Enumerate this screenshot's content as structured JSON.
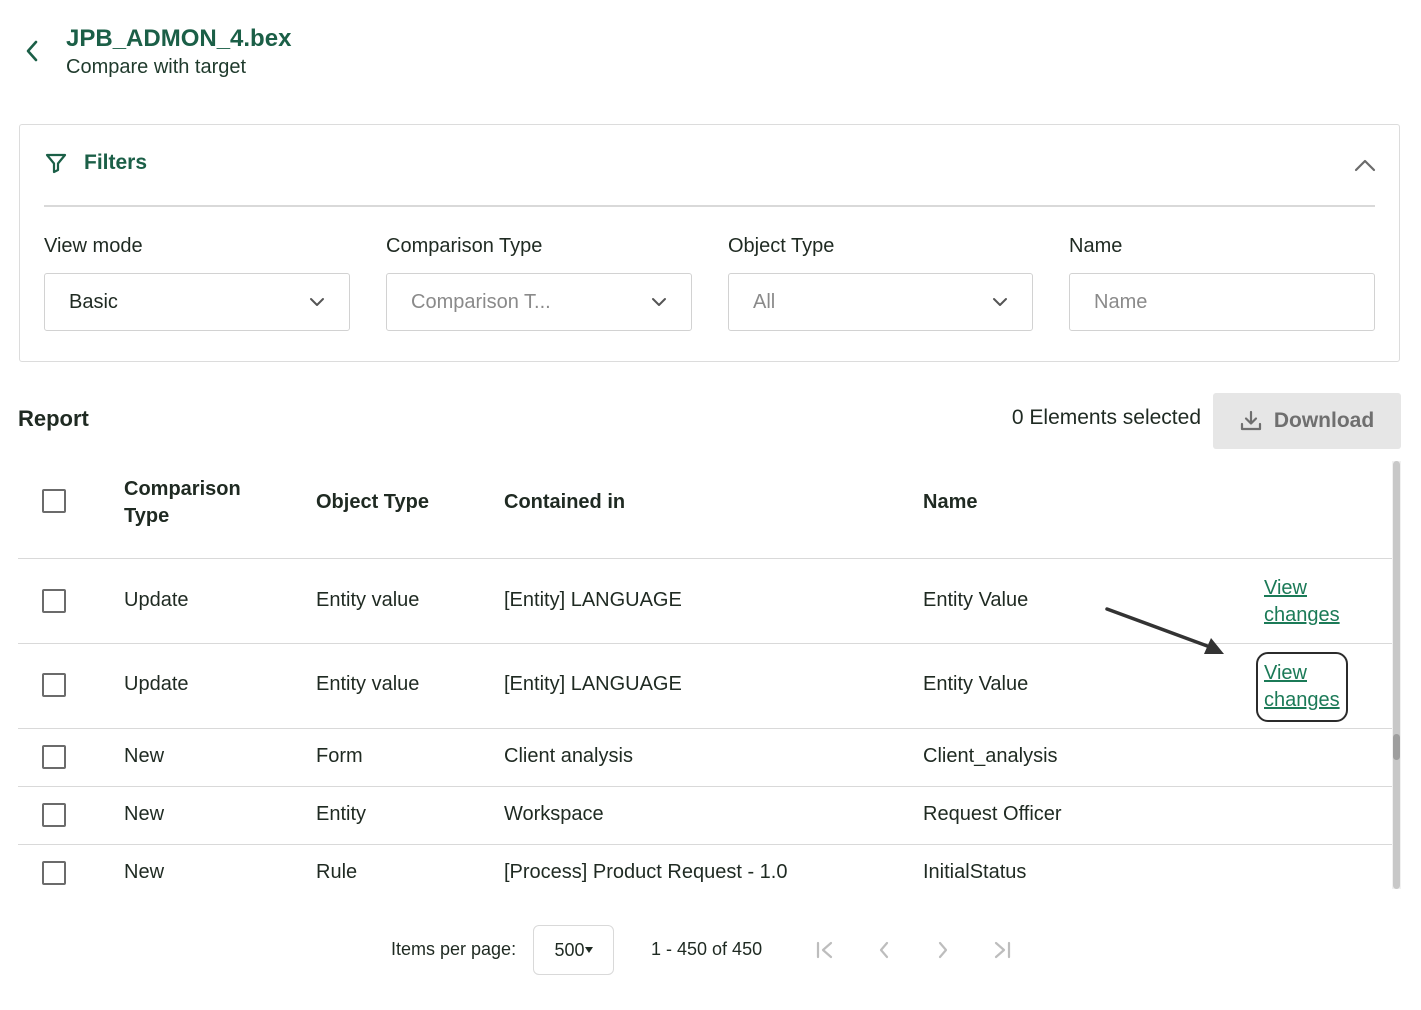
{
  "header": {
    "title": "JPB_ADMON_4.bex",
    "subtitle": "Compare with target"
  },
  "filters": {
    "title": "Filters",
    "view_mode": {
      "label": "View mode",
      "value": "Basic"
    },
    "comparison_type": {
      "label": "Comparison Type",
      "placeholder": "Comparison T..."
    },
    "object_type": {
      "label": "Object Type",
      "value": "All"
    },
    "name": {
      "label": "Name",
      "placeholder": "Name"
    }
  },
  "report": {
    "title": "Report",
    "selected_count": "0 Elements selected",
    "download_label": "Download"
  },
  "table": {
    "columns": {
      "comparison_type_line1": "Comparison",
      "comparison_type_line2": "Type",
      "object_type": "Object Type",
      "contained_in": "Contained in",
      "name": "Name"
    },
    "view_changes_line1": "View",
    "view_changes_line2": "changes",
    "rows": [
      {
        "comparison_type": "Update",
        "object_type": "Entity value",
        "contained_in": "[Entity] LANGUAGE",
        "name": "Entity Value"
      },
      {
        "comparison_type": "Update",
        "object_type": "Entity value",
        "contained_in": "[Entity] LANGUAGE",
        "name": "Entity Value"
      },
      {
        "comparison_type": "New",
        "object_type": "Form",
        "contained_in": "Client analysis",
        "name": "Client_analysis"
      },
      {
        "comparison_type": "New",
        "object_type": "Entity",
        "contained_in": "Workspace",
        "name": "Request Officer"
      },
      {
        "comparison_type": "New",
        "object_type": "Rule",
        "contained_in": "[Process] Product Request - 1.0",
        "name": "InitialStatus"
      }
    ]
  },
  "pagination": {
    "items_per_page_label": "Items per page:",
    "page_size": "500",
    "range": "1 - 450 of 450"
  },
  "colors": {
    "brand_green": "#1b5f47",
    "link_green": "#1b7a57"
  }
}
